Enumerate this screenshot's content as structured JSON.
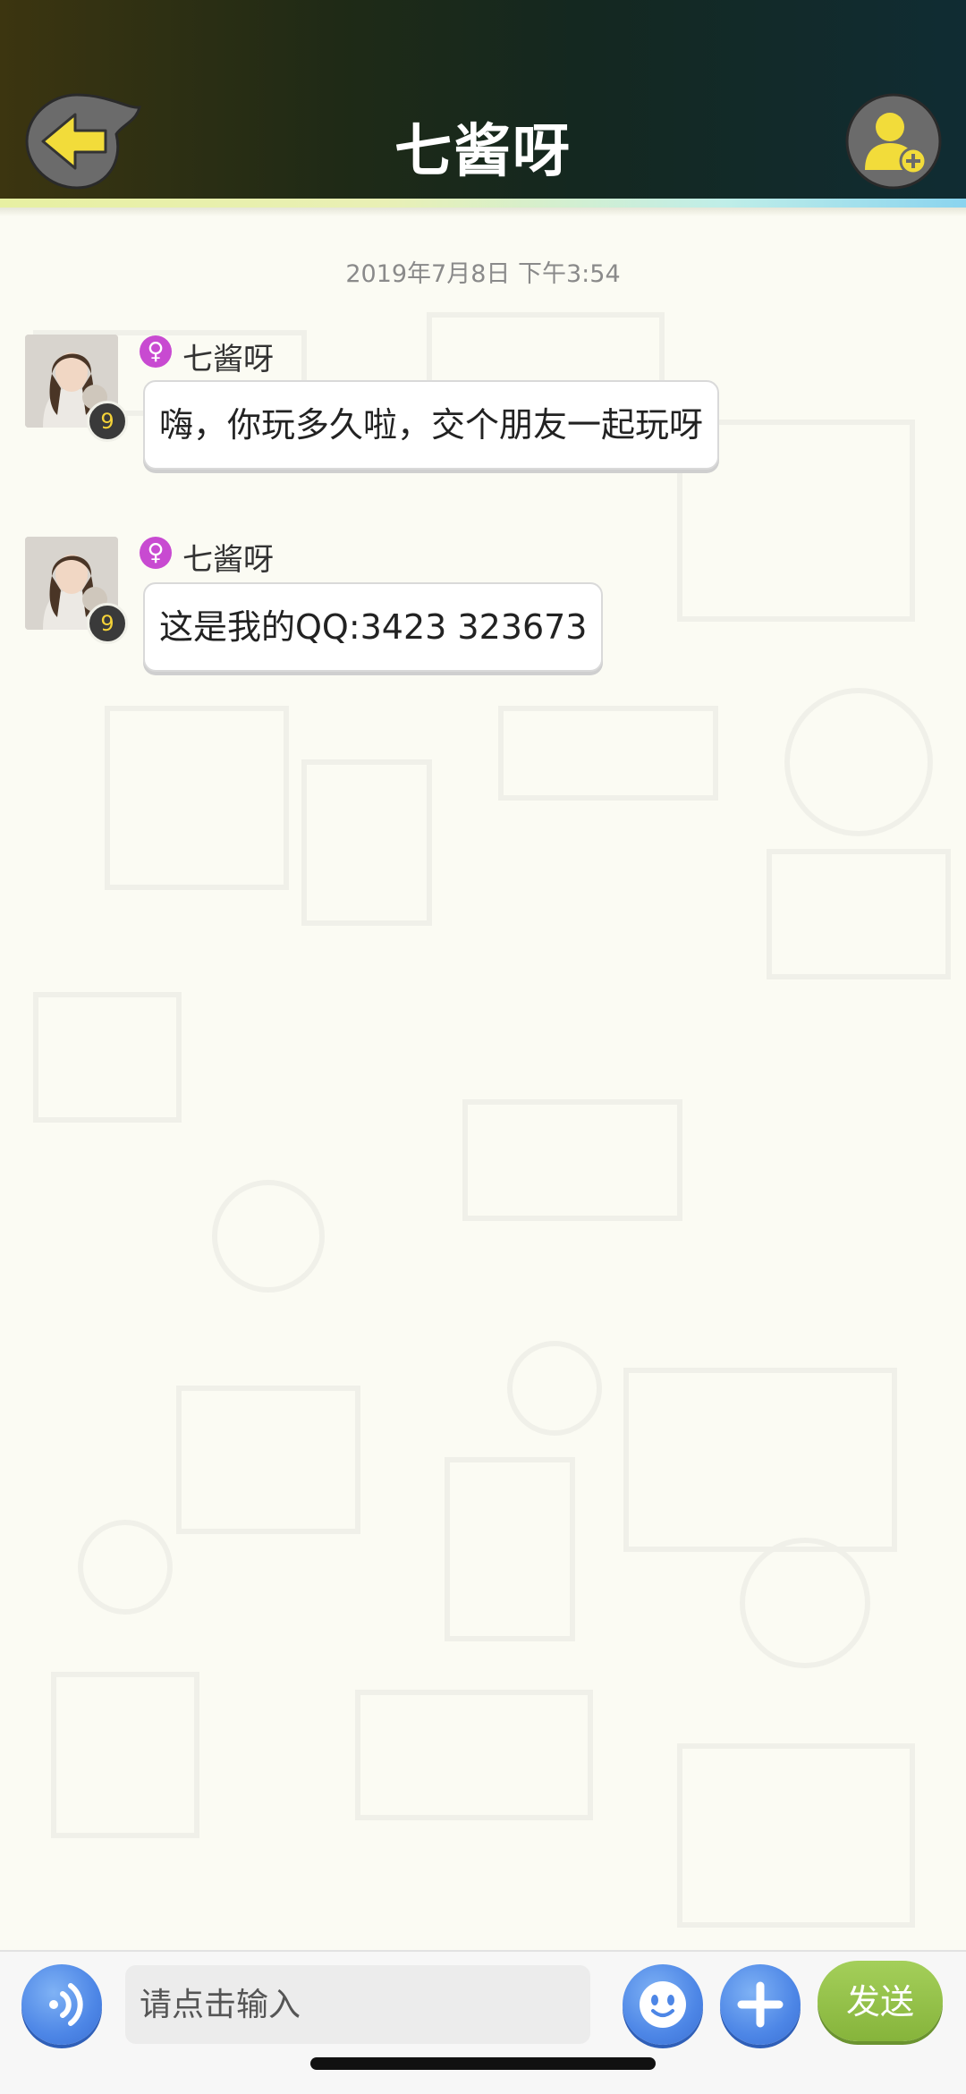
{
  "header": {
    "title": "七酱呀",
    "back_icon": "back-arrow-icon",
    "add_friend_icon": "add-friend-icon"
  },
  "chat": {
    "timestamp": "2019年7月8日 下午3:54",
    "messages": [
      {
        "sender": "七酱呀",
        "gender_symbol": "♀",
        "level": "9",
        "text": "嗨，你玩多久啦，交个朋友一起玩呀"
      },
      {
        "sender": "七酱呀",
        "gender_symbol": "♀",
        "level": "9",
        "text": "这是我的QQ:3423  323673"
      }
    ]
  },
  "composer": {
    "voice_icon": "voice-icon",
    "placeholder": "请点击输入",
    "emoji_icon": "emoji-icon",
    "plus_icon": "plus-icon",
    "send_label": "发送"
  },
  "colors": {
    "accent_blue": "#4d86e6",
    "send_green": "#93c04a",
    "gender_female": "#c84ad1",
    "icon_yellow": "#f2dc3a"
  }
}
